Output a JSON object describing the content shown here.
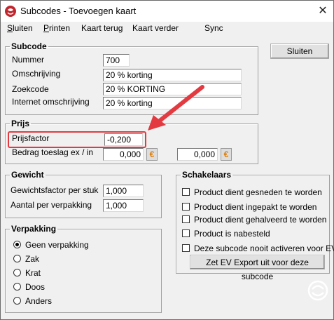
{
  "window": {
    "title": "Subcodes - Toevoegen kaart",
    "close_glyph": "✕"
  },
  "menu": [
    {
      "accel": "S",
      "rest": "luiten"
    },
    {
      "accel": "P",
      "rest": "rinten"
    },
    {
      "accel": "",
      "rest": "Kaart terug"
    },
    {
      "accel": "",
      "rest": "Kaart verder"
    },
    {
      "accel": "",
      "rest": "Sync"
    }
  ],
  "subcode": {
    "legend": "Subcode",
    "nummer_label": "Nummer",
    "nummer_value": "700",
    "omschrijving_label": "Omschrijving",
    "omschrijving_value": "20 % korting",
    "zoekcode_label": "Zoekcode",
    "zoekcode_value": "20 % KORTING",
    "internet_label": "Internet omschrijving",
    "internet_value": "20 % korting"
  },
  "sluiten_button": "Sluiten",
  "prijs": {
    "legend": "Prijs",
    "prijsfactor_label": "Prijsfactor",
    "prijsfactor_value": "-0,200",
    "toeslag_label": "Bedrag toeslag ex / in",
    "toeslag_ex_value": "0,000",
    "toeslag_in_value": "0,000",
    "euro_glyph": "€"
  },
  "gewicht": {
    "legend": "Gewicht",
    "factor_label": "Gewichtsfactor per stuk",
    "factor_value": "1,000",
    "aantal_label": "Aantal per verpakking",
    "aantal_value": "1,000"
  },
  "schakelaars": {
    "legend": "Schakelaars",
    "options": [
      "Product dient gesneden te worden",
      "Product dient ingepakt te worden",
      "Product dient gehalveerd te worden",
      "Product is nabesteld",
      "Deze subcode nooit activeren voor EV"
    ],
    "export_button": "Zet EV Export uit voor deze subcode"
  },
  "verpakking": {
    "legend": "Verpakking",
    "options": [
      "Geen verpakking",
      "Zak",
      "Krat",
      "Doos",
      "Anders"
    ],
    "selected": "Geen verpakking"
  },
  "icons": {
    "app": "app-logo-icon",
    "close": "close-icon",
    "euro": "euro-icon",
    "annotation": "red-arrow-annotation",
    "watermark": "logo-watermark-icon"
  },
  "colors": {
    "annotation": "#e23a40",
    "euro": "#e07b00",
    "logo": "#c0262d"
  }
}
